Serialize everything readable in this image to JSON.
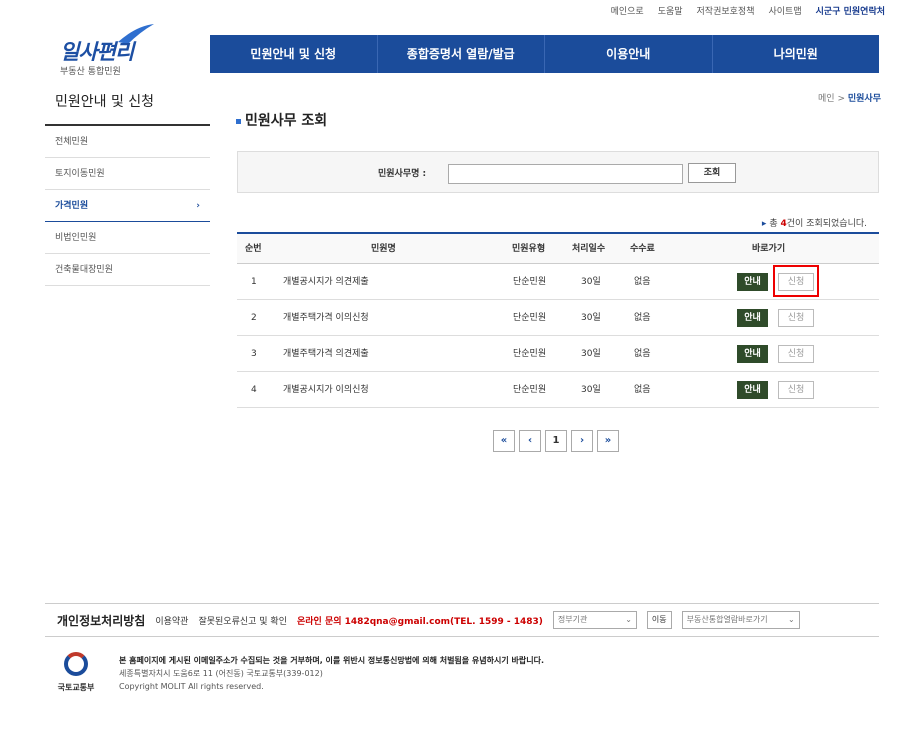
{
  "util_links": [
    "메인으로",
    "도움말",
    "저작권보호정책",
    "사이트맵",
    "시군구 민원연락처"
  ],
  "logo": {
    "main": "일사편리",
    "sub": "부동산 통합민원"
  },
  "gnb": [
    "민원안내 및 신청",
    "종합증명서 열람/발급",
    "이용안내",
    "나의민원"
  ],
  "lnb": {
    "title": "민원안내 및 신청",
    "items": [
      "전체민원",
      "토지이동민원",
      "가격민원",
      "비법인민원",
      "건축물대장민원"
    ],
    "active_index": 2
  },
  "breadcrumb": {
    "home": "메인",
    "sep": ">",
    "current": "민원사무"
  },
  "page_title": "민원사무 조회",
  "search": {
    "label": "민원사무명 :",
    "value": "",
    "button": "조회"
  },
  "result": {
    "prefix": "총 ",
    "count": "4",
    "suffix": "건이 조회되었습니다."
  },
  "table": {
    "headers": [
      "순번",
      "민원명",
      "민원유형",
      "처리일수",
      "수수료",
      "바로가기"
    ],
    "rows": [
      {
        "no": "1",
        "name": "개별공시지가 의견제출",
        "type": "단순민원",
        "days": "30일",
        "fee": "없음",
        "guide": "안내",
        "apply": "신청"
      },
      {
        "no": "2",
        "name": "개별주택가격 이의신청",
        "type": "단순민원",
        "days": "30일",
        "fee": "없음",
        "guide": "안내",
        "apply": "신청"
      },
      {
        "no": "3",
        "name": "개별주택가격 의견제출",
        "type": "단순민원",
        "days": "30일",
        "fee": "없음",
        "guide": "안내",
        "apply": "신청"
      },
      {
        "no": "4",
        "name": "개별공시지가 이의신청",
        "type": "단순민원",
        "days": "30일",
        "fee": "없음",
        "guide": "안내",
        "apply": "신청"
      }
    ]
  },
  "pager": {
    "first": "«",
    "prev": "‹",
    "page": "1",
    "next": "›",
    "last": "»"
  },
  "footer": {
    "privacy": "개인정보처리방침",
    "terms": "이용약관",
    "report": "잘못된오류신고 및 확인",
    "online": "온라인 문의 1482qna@gmail.com(TEL. 1599 - 1483)",
    "select1": "정부기관",
    "go": "이동",
    "select2": "부동산통합열람바로가기",
    "org": "국토교통부",
    "notice": "본 홈페이지에 게시된 이메일주소가 수집되는 것을 거부하며, 이를 위반시 정보통신망법에 의해 처벌됨을 유념하시기 바랍니다.",
    "address": "세종특별자치시 도움6로 11 (어진동) 국토교통부(339-012)",
    "copyright": "Copyright MOLIT All rights reserved."
  }
}
